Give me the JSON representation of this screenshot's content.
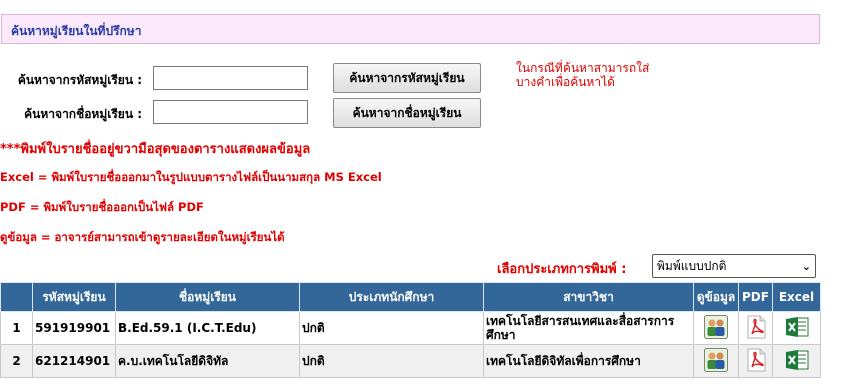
{
  "header": {
    "title": "ค้นหาหมู่เรียนในที่ปรึกษา"
  },
  "search": {
    "code_label": "ค้นหาจากรหัสหมู่เรียน :",
    "code_value": "",
    "code_button": "ค้นหาจากรหัสหมู่เรียน",
    "name_label": "ค้นหาจากชื่อหมู่เรียน :",
    "name_value": "",
    "name_button": "ค้นหาจากชื่อหมู่เรียน",
    "hint": "ในกรณีที่ค้นหาสามารถใส่บางคำเพื่อค้นหาได้"
  },
  "notes": {
    "print_note": "***พิมพ์ใบรายชื่ออยู่ขวามือสุดของตารางแสดงผลข้อมูล",
    "excel_note": "Excel = พิมพ์ใบรายชื่อออกมาในรูปแบบตารางไฟล์เป็นนามสกุล MS Excel",
    "pdf_note": "PDF = พิมพ์ใบรายชื่อออกเป็นไฟล์ PDF",
    "view_note": "ดูข้อมูล = อาจารย์สามารถเข้าดูรายละเอียดในหมู่เรียนได้"
  },
  "print_type": {
    "label": "เลือกประเภทการพิมพ์ :",
    "selected": "พิมพ์แบบปกติ"
  },
  "table": {
    "headers": [
      "",
      "รหัสหมู่เรียน",
      "ชื่อหมู่เรียน",
      "ประเภทนักศึกษา",
      "สาขาวิชา",
      "ดูข้อมูล",
      "PDF",
      "Excel"
    ],
    "rows": [
      {
        "no": "1",
        "code": "591919901",
        "name": "B.Ed.59.1 (I.C.T.Edu)",
        "type": "ปกติ",
        "major": "เทคโนโลยีสารสนเทศและสื่อสารการศึกษา"
      },
      {
        "no": "2",
        "code": "621214901",
        "name": "ค.บ.เทคโนโลยีดิจิทัล",
        "type": "ปกติ",
        "major": "เทคโนโลยีดิจิทัลเพื่อการศึกษา"
      }
    ]
  },
  "icons": {
    "view": "people-icon",
    "pdf": "pdf-icon",
    "excel": "excel-icon"
  },
  "colors": {
    "header_bg": "#336699",
    "note_red": "#e00000",
    "title_blue": "#2a3ea8",
    "panel_pink": "#fbe8fb"
  }
}
